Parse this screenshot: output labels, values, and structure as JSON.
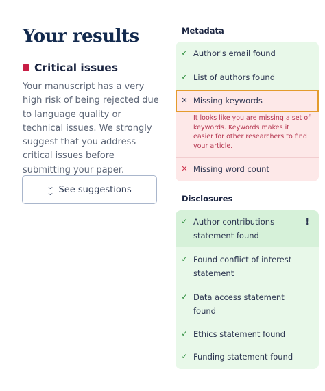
{
  "results": {
    "title": "Your results",
    "severity_label": "Critical issues",
    "severity_color": "#c81e45",
    "description": "Your manuscript has a very high risk of being rejected due to language quality or technical issues. We strongly suggest that you address critical issues before submitting your paper.",
    "suggestions_button": "See suggestions"
  },
  "metadata": {
    "label": "Metadata",
    "items": [
      {
        "status": "ok",
        "icon": "✓",
        "text": "Author's email found"
      },
      {
        "status": "ok",
        "icon": "✓",
        "text": "List of authors found"
      },
      {
        "status": "error",
        "icon": "✕",
        "text": "Missing keywords",
        "detail": "It looks like you are missing a set of keywords. Keywords makes it easier for other researchers to find your article."
      },
      {
        "status": "error",
        "icon": "✕",
        "text": "Missing word count"
      }
    ]
  },
  "disclosures": {
    "label": "Disclosures",
    "items": [
      {
        "status": "ok",
        "icon": "✓",
        "text": "Author contributions statement found",
        "flag": "!"
      },
      {
        "status": "ok",
        "icon": "✓",
        "text": "Found conflict of interest statement"
      },
      {
        "status": "ok",
        "icon": "✓",
        "text": "Data access statement found"
      },
      {
        "status": "ok",
        "icon": "✓",
        "text": "Ethics statement found"
      },
      {
        "status": "ok",
        "icon": "✓",
        "text": "Funding statement found"
      }
    ]
  }
}
